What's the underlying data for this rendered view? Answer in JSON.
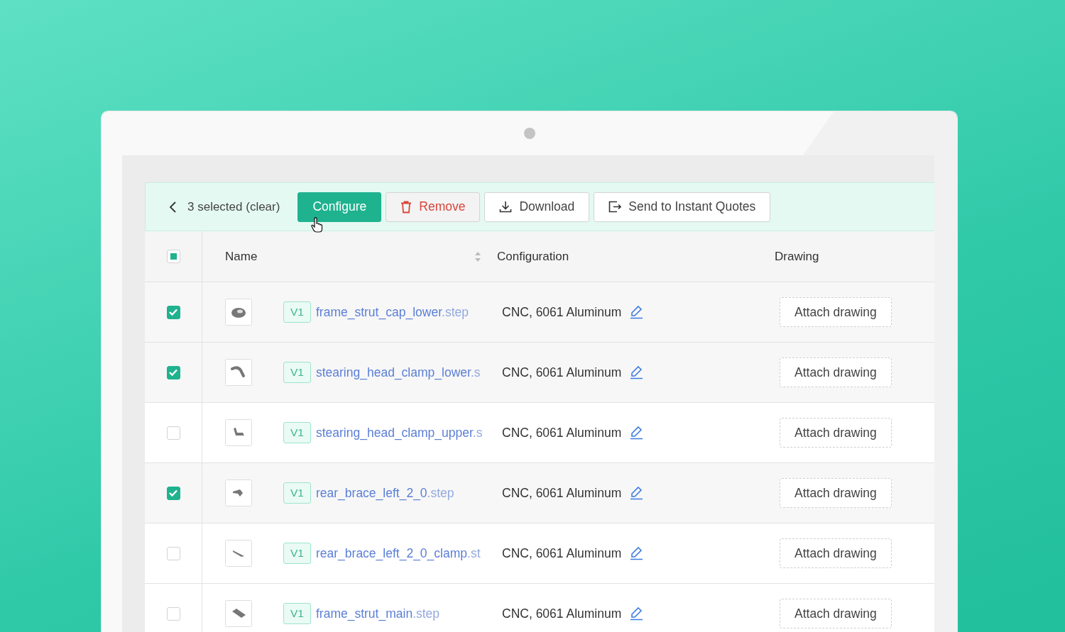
{
  "toolbar": {
    "selection_label": "3 selected (clear)",
    "buttons": [
      {
        "label": "Configure",
        "kind": "primary"
      },
      {
        "label": "Remove",
        "kind": "danger"
      },
      {
        "label": "Download",
        "kind": "download"
      },
      {
        "label": "Send to Instant Quotes",
        "kind": "export"
      }
    ]
  },
  "table": {
    "select_all": {
      "indeterminate": true
    },
    "columns": [
      {
        "label": "Name",
        "sortable": true
      },
      {
        "label": "Configuration",
        "sortable": false
      },
      {
        "label": "Drawing",
        "sortable": false
      }
    ],
    "rows": [
      {
        "selected": true,
        "version": "V1",
        "name": "frame_strut_cap_lower",
        "extension": ".step",
        "configuration": "CNC, 6061 Aluminum",
        "drawing_button": "Attach drawing"
      },
      {
        "selected": true,
        "version": "V1",
        "name": "stearing_head_clamp_lower",
        "extension": ".s",
        "configuration": "CNC, 6061 Aluminum",
        "drawing_button": "Attach drawing"
      },
      {
        "selected": false,
        "version": "V1",
        "name": "stearing_head_clamp_upper",
        "extension": ".s",
        "configuration": "CNC, 6061 Aluminum",
        "drawing_button": "Attach drawing"
      },
      {
        "selected": true,
        "version": "V1",
        "name": "rear_brace_left_2_0",
        "extension": ".step",
        "configuration": "CNC, 6061 Aluminum",
        "drawing_button": "Attach drawing"
      },
      {
        "selected": false,
        "version": "V1",
        "name": "rear_brace_left_2_0_clamp",
        "extension": ".st",
        "configuration": "CNC, 6061 Aluminum",
        "drawing_button": "Attach drawing"
      },
      {
        "selected": false,
        "version": "V1",
        "name": "frame_strut_main",
        "extension": ".step",
        "configuration": "CNC, 6061 Aluminum",
        "drawing_button": "Attach drawing"
      }
    ]
  }
}
